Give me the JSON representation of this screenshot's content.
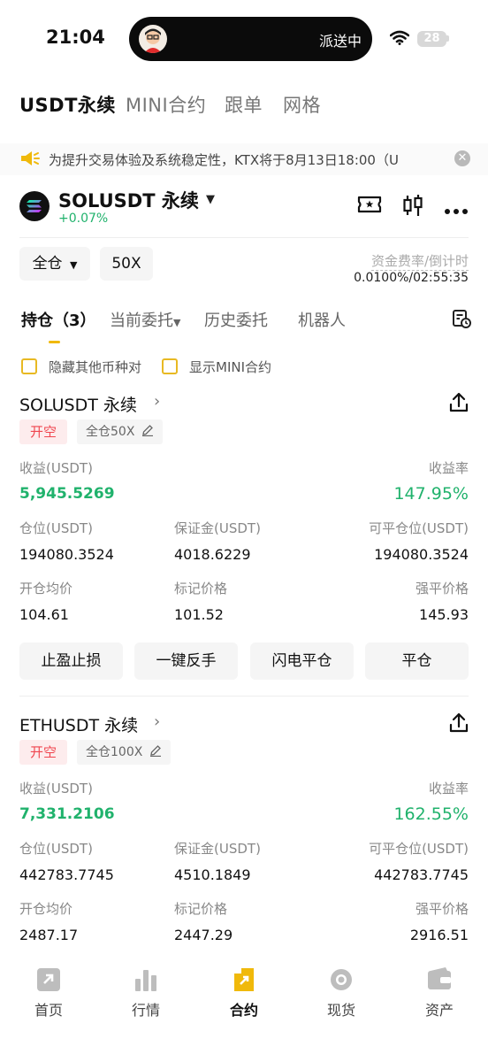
{
  "status_bar": {
    "time": "21:04",
    "island_text": "派送中",
    "battery": "28"
  },
  "top_tabs": [
    {
      "label": "USDT永续",
      "active": true
    },
    {
      "label": "MINI合约",
      "active": false
    },
    {
      "label": "跟单",
      "active": false
    },
    {
      "label": "网格",
      "active": false
    }
  ],
  "notice": {
    "text": "为提升交易体验及系统稳定性，KTX将于8月13日18:00（U"
  },
  "symbol": {
    "title": "SOLUSDT 永续",
    "change": "+0.07%"
  },
  "margin": {
    "mode": "全仓",
    "leverage": "50X",
    "fund_label": "资金费率/倒计时",
    "fund_value": "0.0100%/02:55:35"
  },
  "sub_tabs": [
    {
      "label": "持仓（3）",
      "active": true
    },
    {
      "label": "当前委托",
      "active": false
    },
    {
      "label": "历史委托",
      "active": false
    },
    {
      "label": "机器人",
      "active": false
    }
  ],
  "filters": {
    "hide_other": "隐藏其他币种对",
    "show_mini": "显示MINI合约"
  },
  "labels": {
    "pnl": "收益(USDT)",
    "roe": "收益率",
    "size": "仓位(USDT)",
    "margin": "保证金(USDT)",
    "closable": "可平仓位(USDT)",
    "entry": "开仓均价",
    "mark": "标记价格",
    "liq": "强平价格"
  },
  "positions": [
    {
      "title": "SOLUSDT 永续",
      "side": "开空",
      "mode": "全仓50X",
      "pnl": "5,945.5269",
      "roe": "147.95%",
      "size": "194080.3524",
      "margin": "4018.6229",
      "closable": "194080.3524",
      "entry": "104.61",
      "mark": "101.52",
      "liq": "145.93"
    },
    {
      "title": "ETHUSDT 永续",
      "side": "开空",
      "mode": "全仓100X",
      "pnl": "7,331.2106",
      "roe": "162.55%",
      "size": "442783.7745",
      "margin": "4510.1849",
      "closable": "442783.7745",
      "entry": "2487.17",
      "mark": "2447.29",
      "liq": "2916.51"
    }
  ],
  "actions": {
    "tpsl": "止盈止损",
    "reverse": "一键反手",
    "flash_close": "闪电平仓",
    "close": "平仓"
  },
  "nav": [
    {
      "label": "首页",
      "icon": "home-icon"
    },
    {
      "label": "行情",
      "icon": "market-icon"
    },
    {
      "label": "合约",
      "icon": "futures-icon"
    },
    {
      "label": "现货",
      "icon": "spot-icon"
    },
    {
      "label": "资产",
      "icon": "wallet-icon"
    }
  ],
  "colors": {
    "green": "#20b26c",
    "red": "#f0464f",
    "accent": "#f0b90b"
  }
}
